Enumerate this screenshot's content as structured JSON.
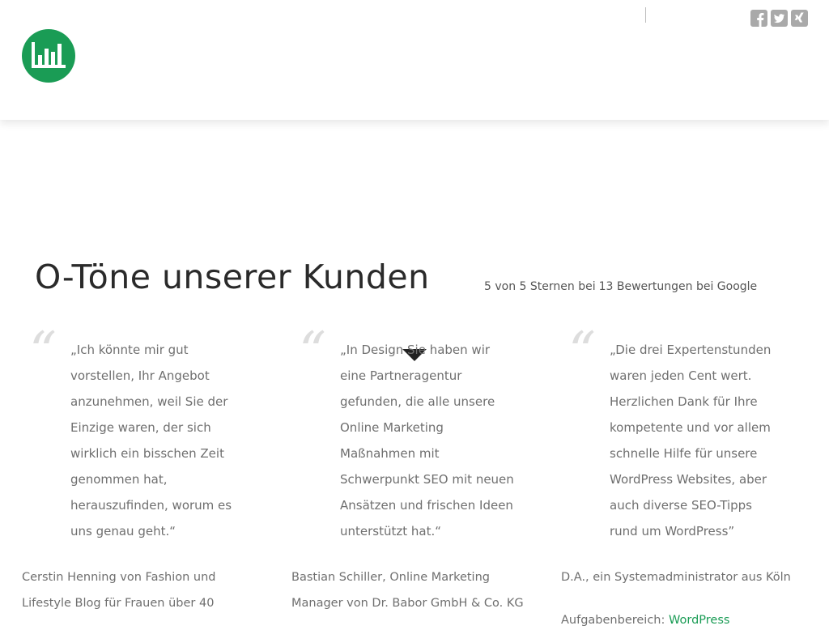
{
  "header": {
    "logo": "bar-chart-logo",
    "social": [
      {
        "icon": "facebook-icon"
      },
      {
        "icon": "twitter-icon"
      },
      {
        "icon": "xing-icon"
      }
    ]
  },
  "section": {
    "title": "O-Töne unserer Kunden",
    "rating": {
      "score_text": "5 von 5 Sternen bei",
      "count_text": "13 Bewertungen bei Google"
    }
  },
  "testimonials": [
    {
      "quote": "„Ich könnte mir gut vorstellen, Ihr Angebot anzunehmen, weil Sie der Einzige waren, der sich wirklich ein bisschen Zeit genommen hat, herauszufinden, worum es uns genau geht.“",
      "author": "Cerstin Henning von Fashion und Lifestyle Blog für Frauen über 40"
    },
    {
      "quote": "„In Design Sie haben wir eine Partneragentur gefunden, die alle unsere Online Marketing Maßnahmen mit Schwerpunkt SEO mit neuen Ansätzen und frischen Ideen unterstützt hat.“",
      "author": "Bastian Schiller, Online Marketing Manager von Dr. Babor GmbH & Co. KG"
    },
    {
      "quote": "„Die drei Expertenstunden waren jeden Cent wert. Herzlichen Dank für Ihre kompetente und vor allem schnelle Hilfe für unsere WordPress Websites, aber auch diverse SEO-Tipps rund um WordPress”",
      "author": "D.A., ein Systemadministrator aus Köln",
      "area_label": "Aufgabenbereich:",
      "area_link": "WordPress"
    }
  ],
  "colors": {
    "brand": "#1a9c55",
    "social": "#a9a9a9",
    "title": "#2a2a2a",
    "body_text": "#6f6f6f",
    "quote_mark": "#dddddd"
  },
  "icons": {
    "scroll": "caret-down-icon",
    "quote": "quote-mark-icon"
  }
}
